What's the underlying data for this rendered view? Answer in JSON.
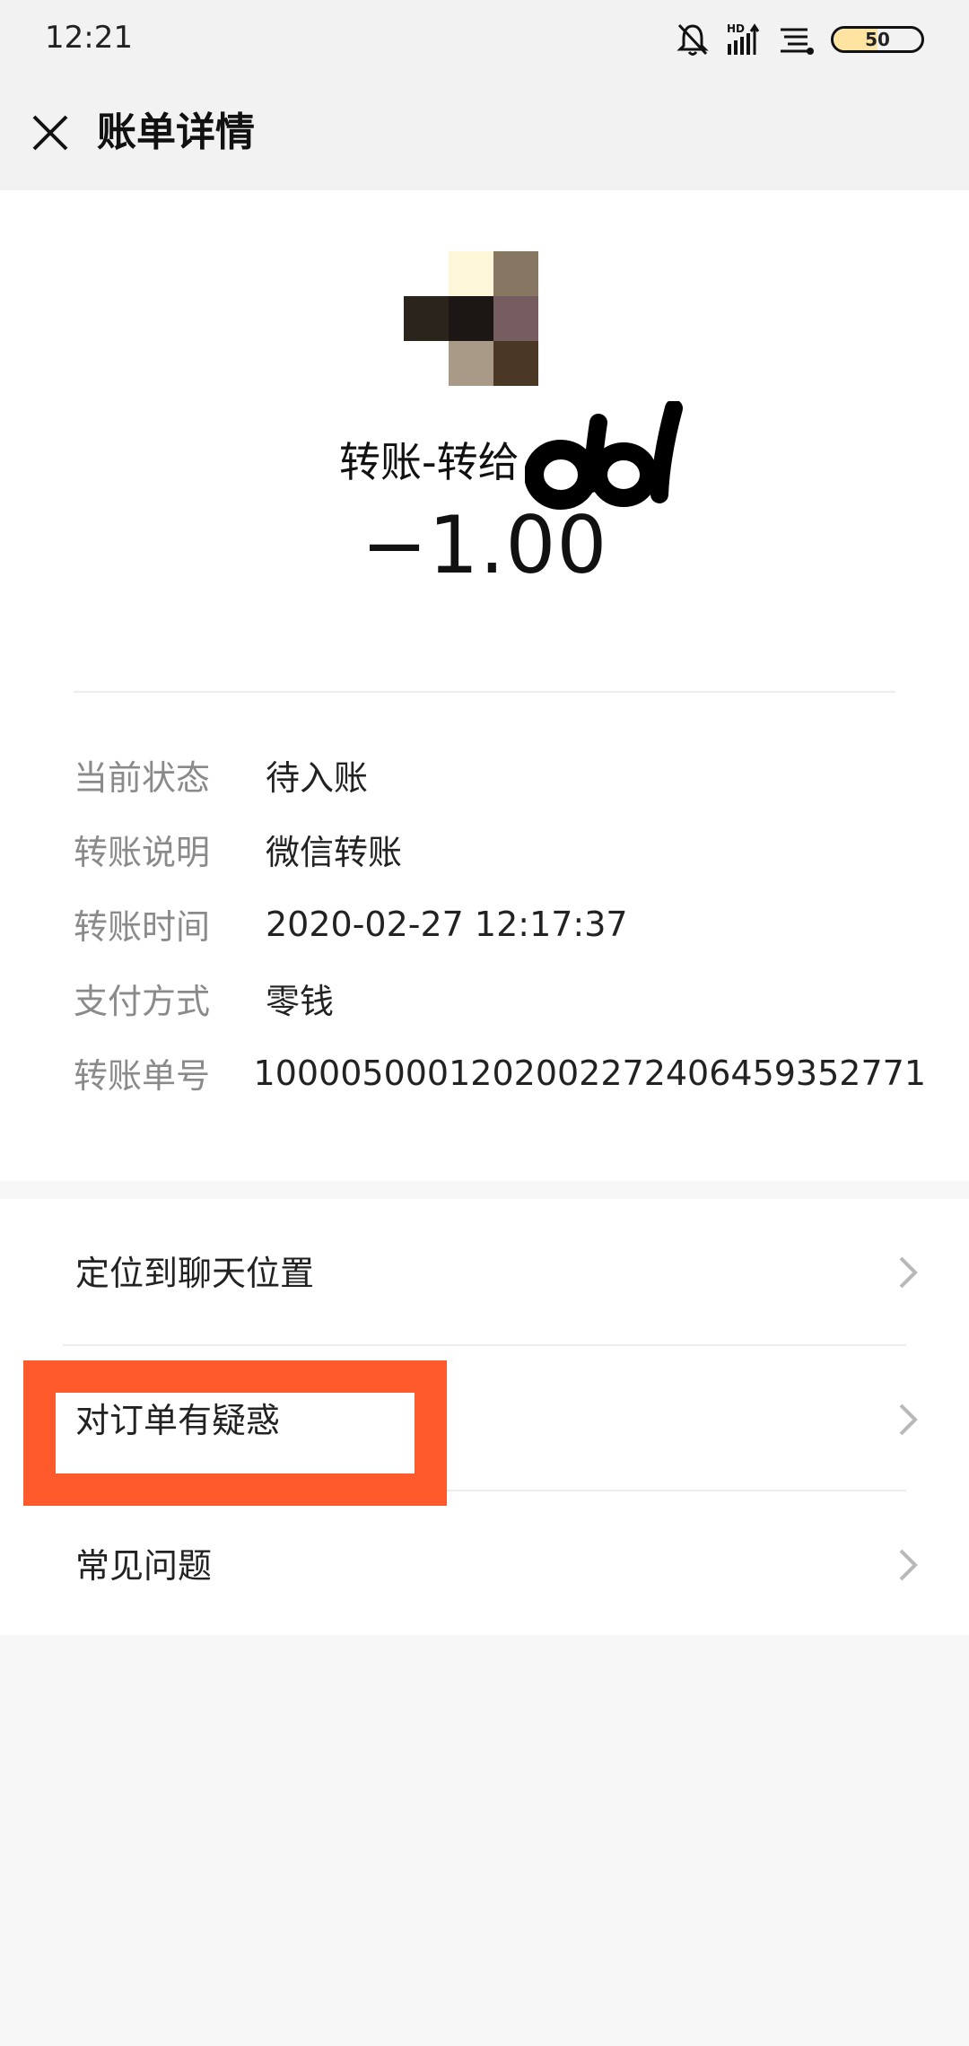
{
  "status_bar": {
    "time": "12:21",
    "icons": [
      "bell-off-icon",
      "hd-signal-icon",
      "wifi-icon"
    ],
    "battery_percent": "50",
    "battery_level": 0.5
  },
  "header": {
    "close_icon": "close-icon",
    "title": "账单详情"
  },
  "transaction": {
    "payee_label": "转账-转给",
    "payee_name": "dd",
    "amount": "−1.00"
  },
  "details": [
    {
      "key": "当前状态",
      "value": "待入账"
    },
    {
      "key": "转账说明",
      "value": "微信转账"
    },
    {
      "key": "转账时间",
      "value": "2020-02-27 12:17:37"
    },
    {
      "key": "支付方式",
      "value": "零钱"
    },
    {
      "key": "转账单号",
      "value": "1000050001202002272406459352771"
    }
  ],
  "menu": [
    {
      "label": "定位到聊天位置"
    },
    {
      "label": "对订单有疑惑"
    },
    {
      "label": "常见问题"
    }
  ],
  "colors": {
    "highlight": "#ff5a2c",
    "header_bg": "#f2f2f2",
    "page_bg": "#f7f7f7"
  }
}
